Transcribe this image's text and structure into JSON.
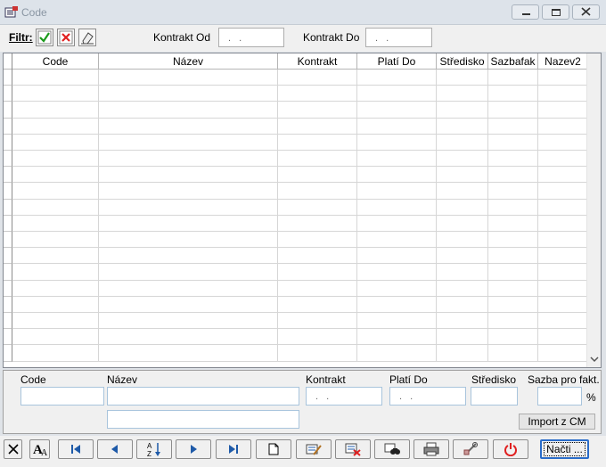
{
  "window": {
    "title": "Code"
  },
  "filter": {
    "label": "Filtr:",
    "kontrakt_od_label": "Kontrakt Od",
    "kontrakt_od_value": ". .",
    "kontrakt_do_label": "Kontrakt Do",
    "kontrakt_do_value": ". ."
  },
  "grid": {
    "columns": [
      "Code",
      "Název",
      "Kontrakt",
      "Platí Do",
      "Středisko",
      "Sazbafak",
      "Nazev2"
    ]
  },
  "detail": {
    "code_label": "Code",
    "nazev_label": "Název",
    "kontrakt_label": "Kontrakt",
    "kontrakt_value": ". .",
    "plati_do_label": "Platí Do",
    "plati_do_value": ". .",
    "stredisko_label": "Středisko",
    "sazba_label": "Sazba pro fakt.",
    "percent": "%",
    "import_button": "Import z CM"
  },
  "toolbar": {
    "nacti_label": "Načti ..."
  },
  "colors": {
    "accent": "#1e5aa8",
    "delete_red": "#e02020",
    "check_green": "#1a9a1a"
  }
}
